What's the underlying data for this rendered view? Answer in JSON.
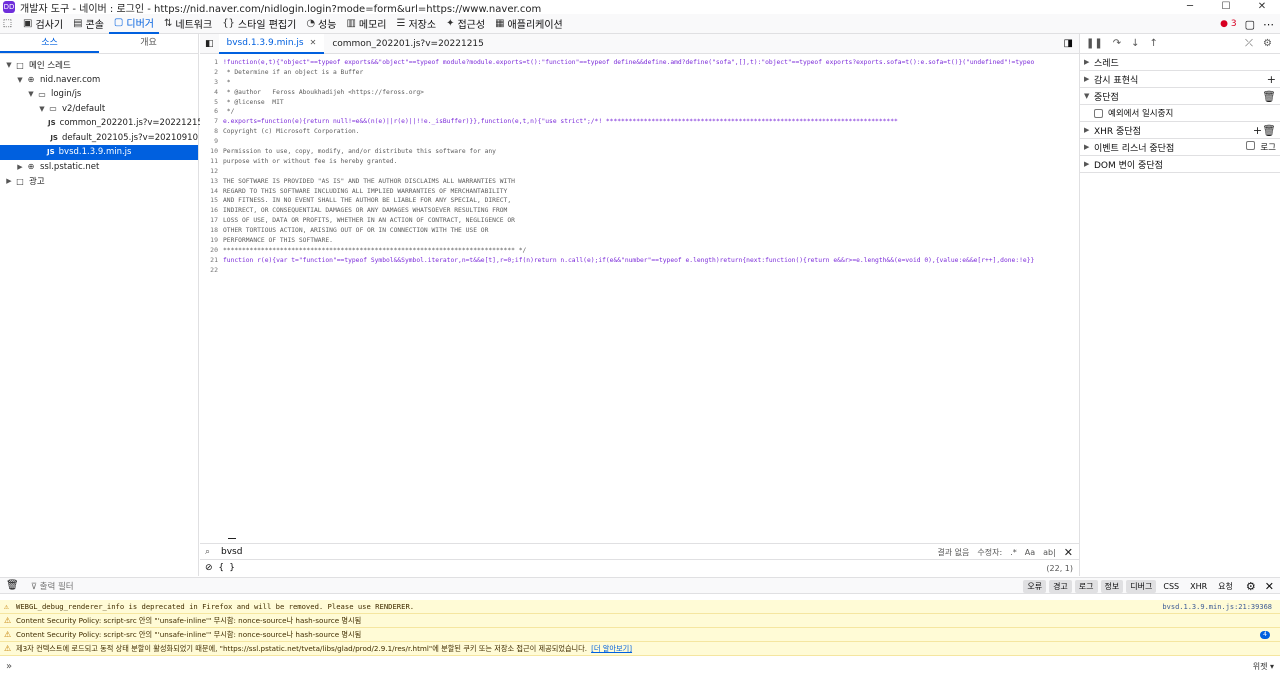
{
  "window": {
    "title": "개발자 도구 - 네이버 : 로그인 - https://nid.naver.com/nidlogin.login?mode=form&url=https://www.naver.com",
    "logo": "DD"
  },
  "toolbar": {
    "items": [
      {
        "label": "검사기",
        "icon": "inspector-icon"
      },
      {
        "label": "콘솔",
        "icon": "console-icon"
      },
      {
        "label": "디버거",
        "icon": "debugger-icon",
        "active": true
      },
      {
        "label": "네트워크",
        "icon": "network-icon"
      },
      {
        "label": "스타일 편집기",
        "icon": "style-editor-icon"
      },
      {
        "label": "성능",
        "icon": "performance-icon"
      },
      {
        "label": "메모리",
        "icon": "memory-icon"
      },
      {
        "label": "저장소",
        "icon": "storage-icon"
      },
      {
        "label": "접근성",
        "icon": "accessibility-icon"
      },
      {
        "label": "애플리케이션",
        "icon": "application-icon"
      }
    ],
    "error_count": "3"
  },
  "left": {
    "tabs": [
      "소스",
      "개요"
    ],
    "tree": [
      {
        "label": "메인 스레드",
        "depth": 0,
        "arrow": "▼",
        "icon": "□"
      },
      {
        "label": "nid.naver.com",
        "depth": 1,
        "arrow": "▼",
        "icon": "⊕"
      },
      {
        "label": "login/js",
        "depth": 2,
        "arrow": "▼",
        "icon": "▭"
      },
      {
        "label": "v2/default",
        "depth": 3,
        "arrow": "▼",
        "icon": "▭"
      },
      {
        "label": "common_202201.js?v=20221215",
        "depth": 4,
        "js": true
      },
      {
        "label": "default_202105.js?v=20210910",
        "depth": 4,
        "js": true
      },
      {
        "label": "bvsd.1.3.9.min.js",
        "depth": 3,
        "js": true,
        "selected": true
      },
      {
        "label": "ssl.pstatic.net",
        "depth": 1,
        "arrow": "▶",
        "icon": "⊕"
      },
      {
        "label": "광고",
        "depth": 0,
        "arrow": "▶",
        "icon": "□"
      }
    ]
  },
  "editor": {
    "tabs": [
      {
        "label": "bvsd.1.3.9.min.js",
        "selected": true
      },
      {
        "label": "common_202201.js?v=20221215"
      }
    ],
    "lines": [
      "!function(e,t){\"object\"==typeof exports&&\"object\"==typeof module?module.exports=t():\"function\"==typeof define&&define.amd?define(\"sofa\",[],t):\"object\"==typeof exports?exports.sofa=t():e.sofa=t()}(\"undefined\"!=typeo",
      " * Determine if an object is a Buffer",
      " *",
      " * @author   Feross Aboukhadijeh <https://feross.org>",
      " * @license  MIT",
      " */",
      "e.exports=function(e){return null!=e&&(n(e)||r(e)||!!e._isBuffer)}},function(e,t,n){\"use strict\";/*! *****************************************************************************",
      "Copyright (c) Microsoft Corporation.",
      "",
      "Permission to use, copy, modify, and/or distribute this software for any",
      "purpose with or without fee is hereby granted.",
      "",
      "THE SOFTWARE IS PROVIDED \"AS IS\" AND THE AUTHOR DISCLAIMS ALL WARRANTIES WITH",
      "REGARD TO THIS SOFTWARE INCLUDING ALL IMPLIED WARRANTIES OF MERCHANTABILITY",
      "AND FITNESS. IN NO EVENT SHALL THE AUTHOR BE LIABLE FOR ANY SPECIAL, DIRECT,",
      "INDIRECT, OR CONSEQUENTIAL DAMAGES OR ANY DAMAGES WHATSOEVER RESULTING FROM",
      "LOSS OF USE, DATA OR PROFITS, WHETHER IN AN ACTION OF CONTRACT, NEGLIGENCE OR",
      "OTHER TORTIOUS ACTION, ARISING OUT OF OR IN CONNECTION WITH THE USE OR",
      "PERFORMANCE OF THIS SOFTWARE.",
      "***************************************************************************** */",
      "function r(e){var t=\"function\"==typeof Symbol&&Symbol.iterator,n=t&&e[t],r=0;if(n)return n.call(e);if(e&&\"number\"==typeof e.length)return{next:function(){return e&&r>=e.length&&(e=void 0),{value:e&&e[r++],done:!e}}",
      ""
    ],
    "line_styles": [
      "kw",
      "cm",
      "cm",
      "cm",
      "cm",
      "cm",
      "kw",
      "cm",
      "cm",
      "cm",
      "cm",
      "cm",
      "cm",
      "cm",
      "cm",
      "cm",
      "cm",
      "cm",
      "cm",
      "cm",
      "kw",
      "cm"
    ],
    "search": {
      "value": "bvsd",
      "result": "결과 없음",
      "modifiers_label": "수정자:",
      "regex": ".*",
      "case": "Aa",
      "word": "ab|"
    },
    "footer": {
      "braces": "{ }",
      "position": "(22, 1)"
    }
  },
  "right": {
    "sections": [
      {
        "label": "스레드",
        "chevron": "▶"
      },
      {
        "label": "감시 표현식",
        "chevron": "▶",
        "action": "+"
      },
      {
        "label": "중단점",
        "chevron": "▼",
        "action": "🗑"
      },
      {
        "label": "예외에서 일시중지",
        "checkbox": true
      },
      {
        "label": "XHR 중단점",
        "chevron": "▶",
        "action": "+🗑"
      },
      {
        "label": "이벤트 리스너 중단점",
        "chevron": "▶",
        "action_checkbox": "로그"
      },
      {
        "label": "DOM 변이 중단점",
        "chevron": "▶"
      }
    ]
  },
  "console": {
    "filter_placeholder": "출력 필터",
    "filters": [
      {
        "label": "오류",
        "on": true
      },
      {
        "label": "경고",
        "on": true
      },
      {
        "label": "로그",
        "on": true
      },
      {
        "label": "정보",
        "on": true
      },
      {
        "label": "디버그",
        "on": true
      },
      {
        "label": "CSS",
        "on": false
      },
      {
        "label": "XHR",
        "on": false
      },
      {
        "label": "요청",
        "on": false
      }
    ],
    "messages": [
      {
        "text": "WEBGL_debug_renderer_info is deprecated in Firefox and will be removed. Please use RENDERER.",
        "source": "bvsd.1.3.9.min.js:21:39368",
        "mono": true
      },
      {
        "text": "Content Security Policy: script-src 안의 \"'unsafe-inline'\" 무시함: nonce-source나 hash-source 명시됨",
        "source": ""
      },
      {
        "text": "Content Security Policy: script-src 안의 \"'unsafe-inline'\" 무시함: nonce-source나 hash-source 명시됨",
        "badge": "4"
      },
      {
        "text": "제3자 컨텍스트에 로드되고 동적 상태 분할이 활성화되었기 때문에, \"https://ssl.pstatic.net/tveta/libs/glad/prod/2.9.1/res/r.html\"에 분할된 쿠키 또는 저장소 접근이 제공되었습니다.",
        "link": "[더 알아보기]"
      }
    ],
    "input_prompt": "»",
    "input_right": "위젯"
  }
}
